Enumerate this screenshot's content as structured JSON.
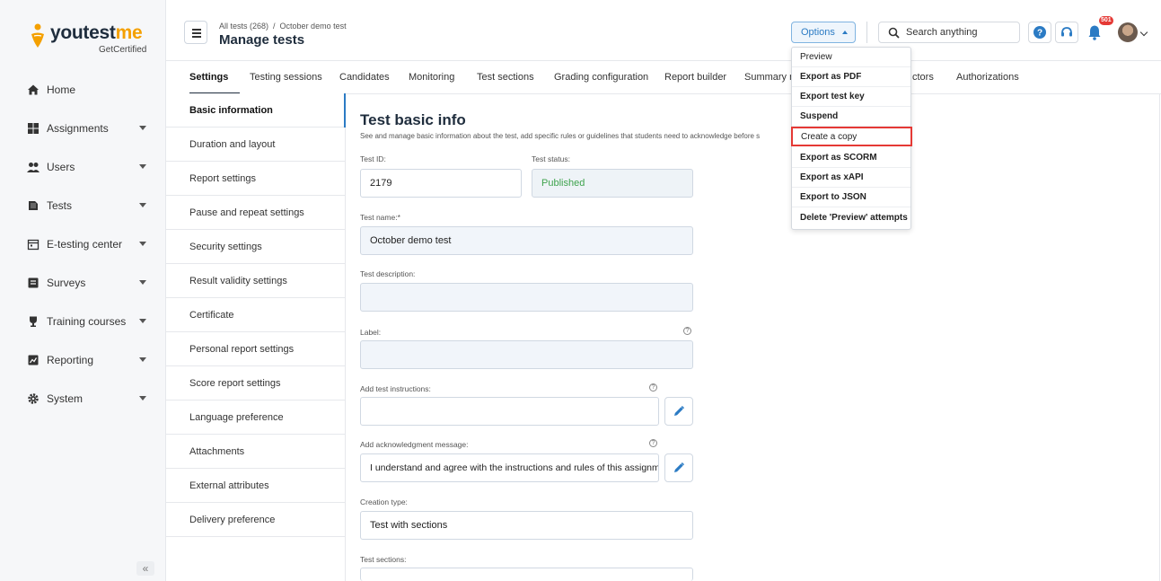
{
  "brand": {
    "name_main": "youtest",
    "name_accent": "me",
    "tagline": "GetCertified"
  },
  "sidebar": {
    "items": [
      {
        "label": "Home",
        "icon": "home-icon"
      },
      {
        "label": "Assignments",
        "icon": "grid-icon"
      },
      {
        "label": "Users",
        "icon": "users-icon"
      },
      {
        "label": "Tests",
        "icon": "tests-icon"
      },
      {
        "label": "E-testing center",
        "icon": "calendar-icon"
      },
      {
        "label": "Surveys",
        "icon": "surveys-icon"
      },
      {
        "label": "Training courses",
        "icon": "trophy-icon"
      },
      {
        "label": "Reporting",
        "icon": "reporting-icon"
      },
      {
        "label": "System",
        "icon": "gear-icon"
      }
    ],
    "collapse_label": "«"
  },
  "header": {
    "breadcrumb_root": "All tests (268)",
    "breadcrumb_sep": "/",
    "breadcrumb_current": "October demo test",
    "title": "Manage tests",
    "options_label": "Options",
    "search_placeholder": "Search anything",
    "notif_count": "501"
  },
  "tabs": [
    {
      "label": "Settings",
      "active": true
    },
    {
      "label": "Testing sessions"
    },
    {
      "label": "Candidates"
    },
    {
      "label": "Monitoring"
    },
    {
      "label": "Test sections"
    },
    {
      "label": "Grading configuration"
    },
    {
      "label": "Report builder"
    },
    {
      "label": "Summary re"
    },
    {
      "label": "ctors"
    },
    {
      "label": "Authorizations"
    }
  ],
  "settings_nav": [
    "Basic information",
    "Duration and layout",
    "Report settings",
    "Pause and repeat settings",
    "Security settings",
    "Result validity settings",
    "Certificate",
    "Personal report settings",
    "Score report settings",
    "Language preference",
    "Attachments",
    "External attributes",
    "Delivery preference"
  ],
  "form": {
    "title": "Test basic info",
    "description": "See and manage basic information about the test, add specific rules or guidelines that students need to acknowledge before s",
    "test_id_label": "Test ID:",
    "test_id_value": "2179",
    "test_status_label": "Test status:",
    "test_status_value": "Published",
    "test_name_label": "Test name:*",
    "test_name_value": "October demo test",
    "test_description_label": "Test description:",
    "test_description_value": "",
    "label_label": "Label:",
    "label_value": "",
    "instructions_label": "Add test instructions:",
    "instructions_value": "",
    "ack_label": "Add acknowledgment message:",
    "ack_value": "I understand and agree with the instructions and rules of this assignme...",
    "creation_type_label": "Creation type:",
    "creation_type_value": "Test with sections",
    "test_sections_label": "Test sections:"
  },
  "options_menu": [
    {
      "label": "Preview",
      "bold": false
    },
    {
      "label": "Export as PDF",
      "bold": true
    },
    {
      "label": "Export test key",
      "bold": true
    },
    {
      "label": "Suspend",
      "bold": true
    },
    {
      "label": "Create a copy",
      "bold": false,
      "highlighted": true
    },
    {
      "label": "Export as SCORM",
      "bold": true
    },
    {
      "label": "Export as xAPI",
      "bold": true
    },
    {
      "label": "Export to JSON",
      "bold": true
    },
    {
      "label": "Delete 'Preview' attempts",
      "bold": true
    }
  ],
  "colors": {
    "accent": "#2b7bc4",
    "brand_orange": "#f4a000",
    "published_green": "#3fa34d",
    "highlight_red": "#e53935"
  }
}
